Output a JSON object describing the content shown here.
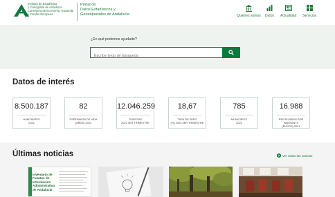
{
  "header": {
    "institution_lines": [
      "Instituto de Estadística",
      "y Cartografía de Andalucía",
      "Consejería de Economía, Hacienda",
      "y Fondos Europeos"
    ],
    "portal_lines": [
      "Portal de",
      "Datos Estadísticos y",
      "Geoespaciales de Andalucía"
    ],
    "nav": [
      {
        "label": "Quienes somos",
        "icon": "building-icon"
      },
      {
        "label": "Datos",
        "icon": "chart-icon"
      },
      {
        "label": "Actualidad",
        "icon": "news-icon"
      },
      {
        "label": "Servicios",
        "icon": "grid-icon"
      }
    ]
  },
  "search": {
    "prompt": "¿En qué podemos ayudarte?",
    "placeholder": "Escribe texto de búsqueda"
  },
  "datos": {
    "title": "Datos de interés",
    "cards": [
      {
        "value": "8.500.187",
        "label_lines": [
          "HABITANTES",
          "2022"
        ]
      },
      {
        "value": "82",
        "label_lines": [
          "ESPERANZA DE VIDA",
          "(AÑOS) 2022"
        ]
      },
      {
        "value": "12.046.259",
        "label_lines": [
          "TURISTAS",
          "2023 3ER TRIMESTRE"
        ]
      },
      {
        "value": "18,67",
        "label_lines": [
          "TASA DE PARO",
          "(%) 2023 3ER TRIMESTRE"
        ]
      },
      {
        "value": "785",
        "label_lines": [
          "MUNICIPIOS",
          "2022"
        ]
      },
      {
        "value": "16.988",
        "label_lines": [
          "RENTA MEDIA POR HABITANTE",
          "(EUROS) 2021"
        ]
      }
    ]
  },
  "noticias": {
    "title": "Últimas noticias",
    "see_all": "Ver todas las noticias",
    "thumb_text_lines": [
      "Inventario de",
      "Fuentes de",
      "Información",
      "Administrativa",
      "de Andalucía"
    ]
  },
  "colors": {
    "brand_green": "#0b7a3e",
    "search_band": "#eef3ef"
  }
}
